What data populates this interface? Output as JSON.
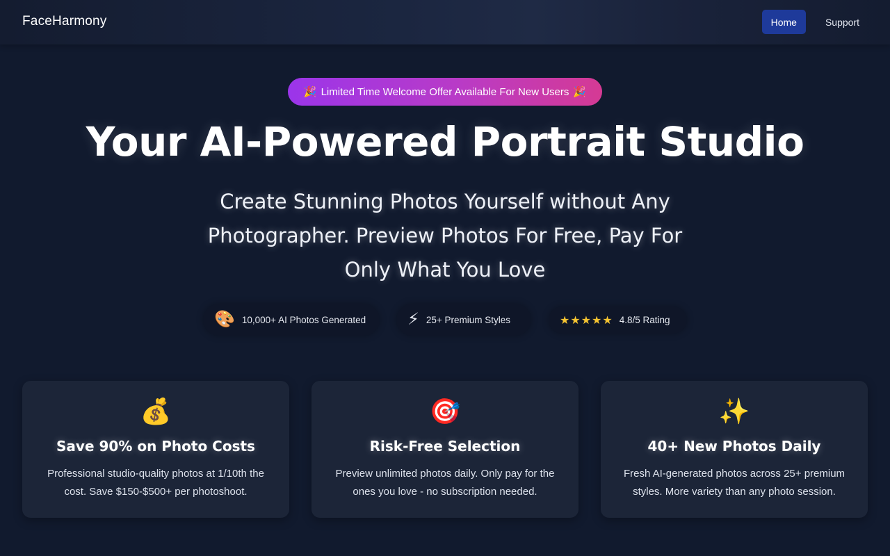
{
  "header": {
    "brand": "FaceHarmony",
    "nav": [
      {
        "label": "Home",
        "active": true
      },
      {
        "label": "Support",
        "active": false
      }
    ]
  },
  "hero": {
    "promo": {
      "emoji_left": "🎉",
      "text": "Limited Time Welcome Offer Available For New Users",
      "emoji_right": "🎉"
    },
    "headline": "Your AI-Powered Portrait Studio",
    "subheadline": "Create Stunning Photos Yourself without Any Photographer. Preview Photos For Free, Pay For Only What You Love"
  },
  "stats": [
    {
      "icon": "palette-icon",
      "glyph": "🎨",
      "label": "10,000+ AI Photos Generated"
    },
    {
      "icon": "lightning-icon",
      "glyph": "⚡",
      "label": "25+ Premium Styles"
    },
    {
      "icon": "stars-icon",
      "glyph": "★★★★★",
      "label": "4.8/5 Rating"
    }
  ],
  "features": [
    {
      "icon": "money-bag-icon",
      "glyph": "💰",
      "title": "Save 90% on Photo Costs",
      "description": "Professional studio-quality photos at 1/10th the cost. Save $150-$500+ per photoshoot."
    },
    {
      "icon": "target-icon",
      "glyph": "🎯",
      "title": "Risk-Free Selection",
      "description": "Preview unlimited photos daily. Only pay for the ones you love - no subscription needed."
    },
    {
      "icon": "sparkles-icon",
      "glyph": "✨",
      "title": "40+ New Photos Daily",
      "description": "Fresh AI-generated photos across 25+ premium styles. More variety than any photo session."
    }
  ],
  "colors": {
    "background": "#111a2e",
    "card": "#1c2538",
    "nav_active": "#1e3a9a",
    "promo_gradient_start": "#9b35ea",
    "promo_gradient_end": "#d53a94",
    "star": "#f6c431"
  }
}
